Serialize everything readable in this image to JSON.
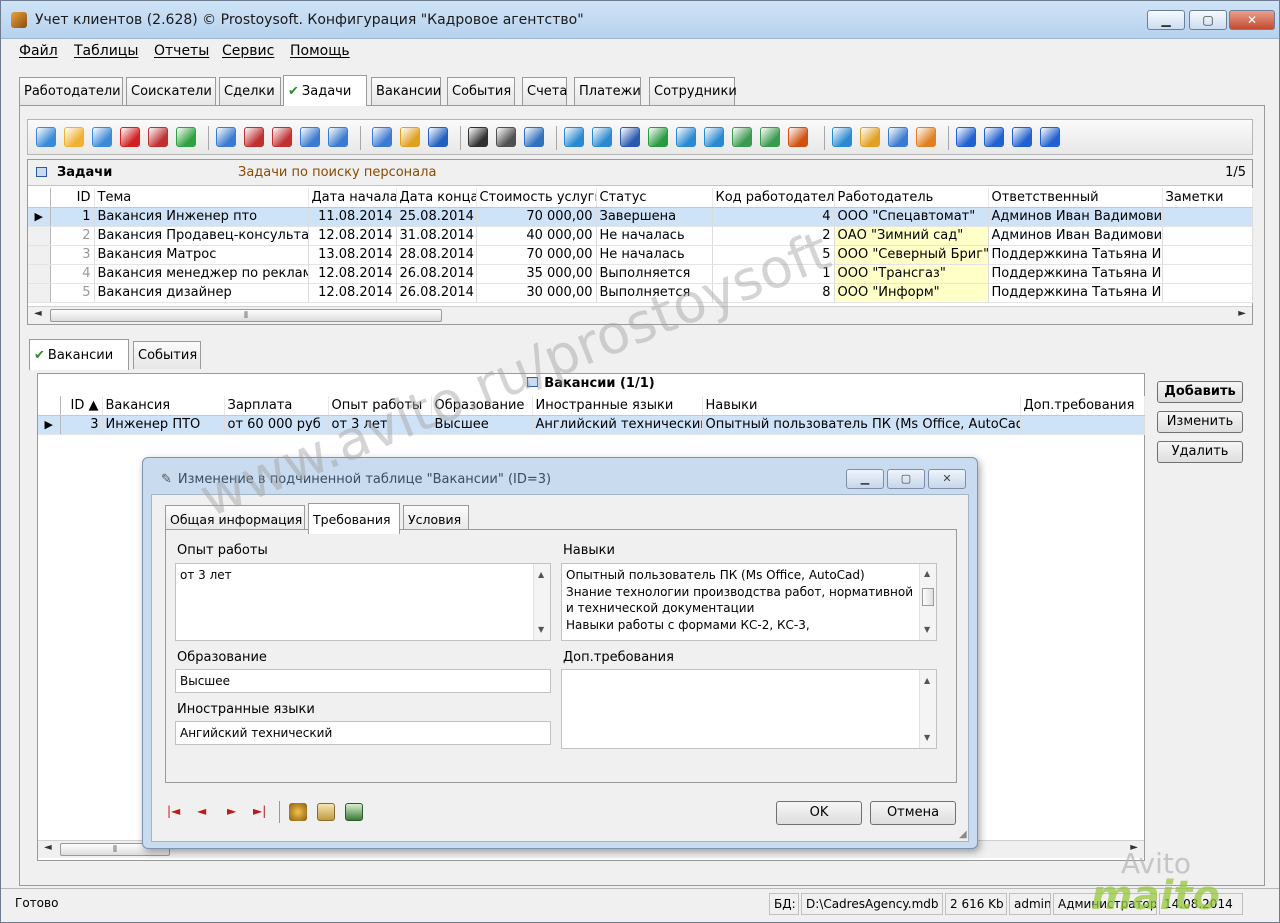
{
  "window": {
    "title": "Учет клиентов (2.628) © Prostoysoft. Конфигурация \"Кадровое агентство\""
  },
  "menu": [
    "Файл",
    "Таблицы",
    "Отчеты",
    "Сервис",
    "Помощь"
  ],
  "main_tabs": [
    "Работодатели",
    "Соискатели",
    "Сделки",
    "Задачи",
    "Вакансии",
    "События",
    "Счета",
    "Платежи",
    "Сотрудники"
  ],
  "active_main_tab": "Задачи",
  "toolbar_icons": [
    "add-record-icon",
    "edit-icon",
    "copy-icon",
    "delete-icon",
    "table-icon",
    "refresh-icon",
    "filter-icon",
    "filter-remove-icon",
    "filter-clear-icon",
    "filter-set-icon",
    "filter-edit-icon",
    "funnel-icon",
    "group-icon",
    "sql-icon",
    "find-icon",
    "print-icon",
    "preview-icon",
    "export-icon",
    "export2-icon",
    "word-icon",
    "excel-icon",
    "doc-icon",
    "import-icon",
    "html-icon",
    "csv-icon",
    "chart-icon",
    "music-icon",
    "info-icon",
    "list-icon",
    "columns-icon",
    "first-icon",
    "prev-icon",
    "next-icon",
    "last-icon"
  ],
  "tasks": {
    "title": "Задачи",
    "subtitle": "Задачи по поиску персонала",
    "counter": "1/5",
    "columns": [
      "ID",
      "Тема",
      "Дата начала",
      "Дата конца",
      "Стоимость услуги",
      "Статус",
      "Код работодателя",
      "Работодатель",
      "Ответственный",
      "Заметки"
    ],
    "rows": [
      [
        "1",
        "Вакансия Инженер пто",
        "11.08.2014",
        "25.08.2014",
        "70 000,00",
        "Завершена",
        "4",
        "ООО \"Спецавтомат\"",
        "Админов Иван Вадимович",
        ""
      ],
      [
        "2",
        "Вакансия Продавец-консультант",
        "12.08.2014",
        "31.08.2014",
        "40 000,00",
        "Не началась",
        "2",
        "ОАО \"Зимний сад\"",
        "Админов Иван Вадимович",
        ""
      ],
      [
        "3",
        "Вакансия Матрос",
        "13.08.2014",
        "28.08.2014",
        "70 000,00",
        "Не началась",
        "5",
        "ООО \"Северный Бриг\"",
        "Поддержкина Татьяна Ив.",
        ""
      ],
      [
        "4",
        "Вакансия менеджер по рекламе",
        "12.08.2014",
        "26.08.2014",
        "35 000,00",
        "Выполняется",
        "1",
        "ООО \"Трансгаз\"",
        "Поддержкина Татьяна Ив.",
        ""
      ],
      [
        "5",
        "Вакансия дизайнер",
        "12.08.2014",
        "26.08.2014",
        "30 000,00",
        "Выполняется",
        "8",
        "ООО \"Информ\"",
        "Поддержкина Татьяна Ив.",
        ""
      ]
    ]
  },
  "sub_tabs": [
    "Вакансии",
    "События"
  ],
  "vacancies": {
    "title": "Вакансии (1/1)",
    "columns": [
      "ID",
      "Вакансия",
      "Зарплата",
      "Опыт работы",
      "Образование",
      "Иностранные языки",
      "Навыки",
      "Доп.требования"
    ],
    "rows": [
      [
        "3",
        "Инженер ПТО",
        "от 60 000 руб",
        "от 3 лет",
        "Высшее",
        "Английский технический",
        "Опытный пользователь ПК (Ms Office, AutoCad)",
        ""
      ]
    ]
  },
  "side_buttons": {
    "add": "Добавить",
    "edit": "Изменить",
    "delete": "Удалить"
  },
  "dialog": {
    "title": "Изменение в подчиненной таблице \"Вакансии\" (ID=3)",
    "tabs": [
      "Общая информация",
      "Требования",
      "Условия"
    ],
    "active_tab": "Требования",
    "experience_label": "Опыт работы",
    "experience_value": "от 3 лет",
    "skills_label": "Навыки",
    "skills_lines": [
      "Опытный пользователь ПК (Ms Office, AutoCad)",
      "Знание технологии производства работ, нормативной",
      "и технической документации",
      "Навыки работы с формами КС-2, КС-3,"
    ],
    "education_label": "Образование",
    "education_value": "Высшее",
    "extra_label": "Доп.требования",
    "extra_value": "",
    "languages_label": "Иностранные языки",
    "languages_value": "Ангийский технический",
    "ok": "OK",
    "cancel": "Отмена"
  },
  "status": {
    "ready": "Готово",
    "db_label": "БД:",
    "db_path": "D:\\CadresAgency.mdb",
    "db_size": "2 616 Kb",
    "user": "admin",
    "role": "Администратор",
    "date": "14.08.2014"
  },
  "watermark": {
    "url": "www.avito.ru/prostoysoft",
    "brand": "Avito",
    "brand2": "maito"
  },
  "colors": {
    "selection": "#cfe3f8",
    "highlight_employer": "#ffffc8",
    "title_bar": "#c6dcf2",
    "subtitle": "#8a4a00"
  }
}
